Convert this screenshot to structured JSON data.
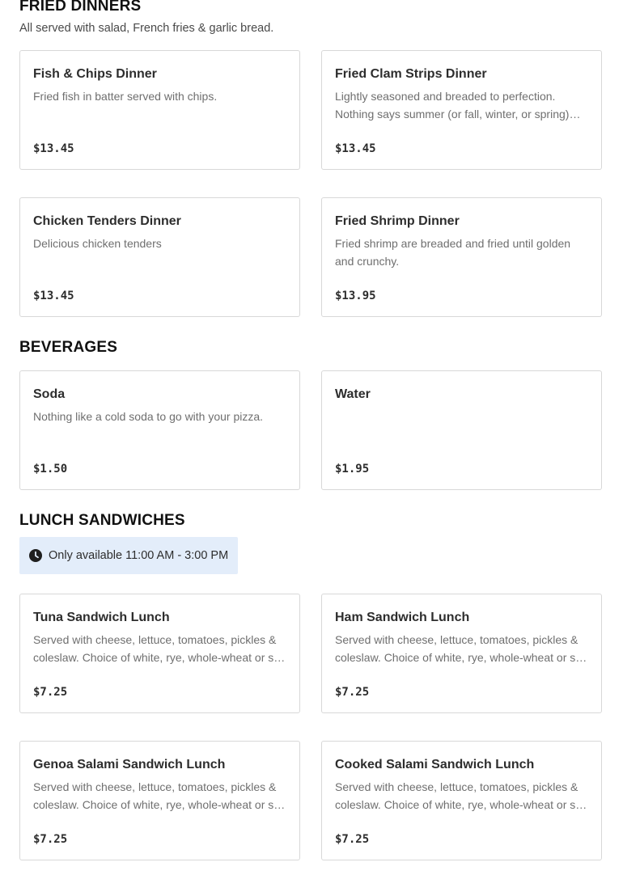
{
  "sections": {
    "fried_dinners": {
      "title": "FRIED DINNERS",
      "subtitle": "All served with salad, French fries & garlic bread.",
      "items": [
        {
          "name": "Fish & Chips Dinner",
          "description": "Fried fish in batter served with chips.",
          "price": "$13.45"
        },
        {
          "name": "Fried Clam Strips Dinner",
          "description": "Lightly seasoned and breaded to perfection. Nothing says summer (or fall, winter, or spring) like fried clam strips.",
          "price": "$13.45"
        },
        {
          "name": "Chicken Tenders Dinner",
          "description": "Delicious chicken tenders",
          "price": "$13.45"
        },
        {
          "name": "Fried Shrimp Dinner",
          "description": "Fried shrimp are breaded and fried until golden and crunchy.",
          "price": "$13.95"
        }
      ]
    },
    "beverages": {
      "title": "BEVERAGES",
      "items": [
        {
          "name": "Soda",
          "description": "Nothing like a cold soda to go with your pizza.",
          "price": "$1.50"
        },
        {
          "name": "Water",
          "description": "",
          "price": "$1.95"
        }
      ]
    },
    "lunch_sandwiches": {
      "title": "LUNCH SANDWICHES",
      "availability": "Only available 11:00 AM - 3:00 PM",
      "items": [
        {
          "name": "Tuna Sandwich Lunch",
          "description": "Served with cheese, lettuce, tomatoes, pickles & coleslaw. Choice of white, rye, whole-wheat or sub roll.",
          "price": "$7.25"
        },
        {
          "name": "Ham Sandwich Lunch",
          "description": "Served with cheese, lettuce, tomatoes, pickles & coleslaw. Choice of white, rye, whole-wheat or sub roll.",
          "price": "$7.25"
        },
        {
          "name": "Genoa Salami Sandwich Lunch",
          "description": "Served with cheese, lettuce, tomatoes, pickles & coleslaw. Choice of white, rye, whole-wheat or sub roll.",
          "price": "$7.25"
        },
        {
          "name": "Cooked Salami Sandwich Lunch",
          "description": "Served with cheese, lettuce, tomatoes, pickles & coleslaw. Choice of white, rye, whole-wheat or sub roll.",
          "price": "$7.25"
        }
      ]
    }
  },
  "icons": {
    "availability": "clock-icon"
  },
  "colors": {
    "availability_bg": "#e3edfa",
    "card_border": "#d8d8d8",
    "description_text": "#6f6f6f"
  }
}
